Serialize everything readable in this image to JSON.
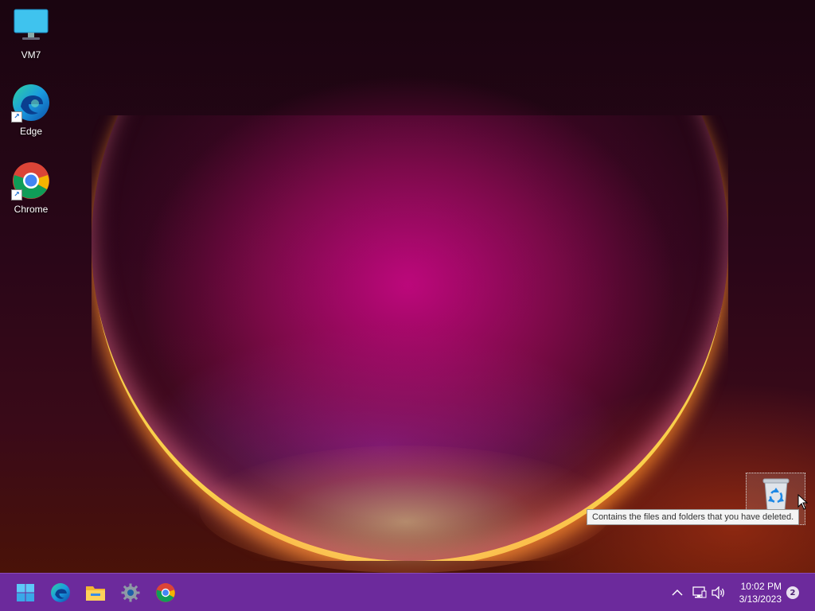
{
  "desktop": {
    "icons": [
      {
        "label": "VM7",
        "icon": "monitor-icon"
      },
      {
        "label": "Edge",
        "icon": "edge-icon"
      },
      {
        "label": "Chrome",
        "icon": "chrome-icon"
      }
    ],
    "recycle_bin": {
      "icon": "recycle-bin-icon",
      "tooltip": "Contains the files and folders that you have deleted."
    }
  },
  "taskbar": {
    "apps": [
      {
        "name": "Start",
        "icon": "windows-logo-icon"
      },
      {
        "name": "Edge",
        "icon": "edge-icon"
      },
      {
        "name": "File Explorer",
        "icon": "folder-icon"
      },
      {
        "name": "Settings",
        "icon": "gear-icon"
      },
      {
        "name": "Chrome",
        "icon": "chrome-icon"
      }
    ],
    "tray": {
      "time": "10:02 PM",
      "date": "3/13/2023",
      "notification_count": "2"
    }
  },
  "colors": {
    "taskbar": "#6c2a9c",
    "accent": "#1a6fd0"
  }
}
